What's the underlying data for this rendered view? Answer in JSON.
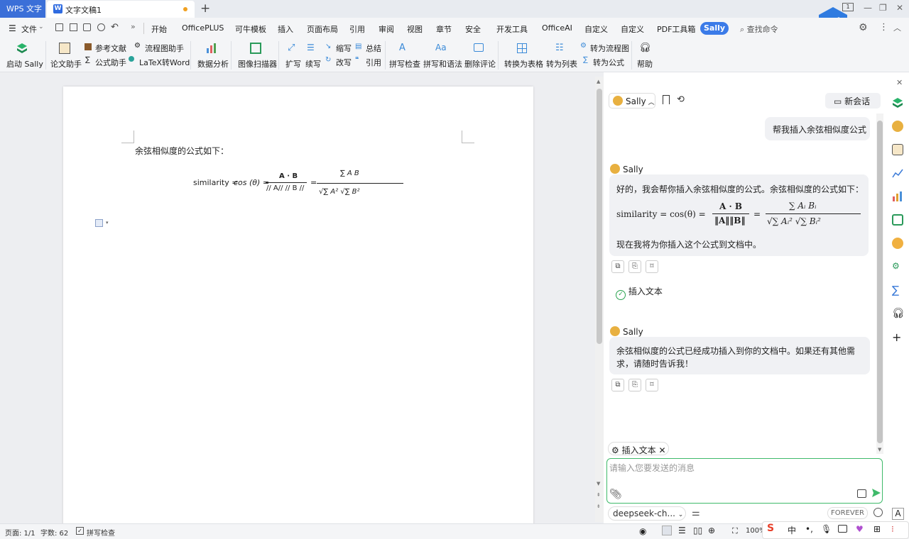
{
  "titlebar": {
    "app_name": "WPS 文字",
    "doc_tab": "文字文稿1",
    "new_tab": "+"
  },
  "menu": {
    "file": "文件",
    "items": [
      "开始",
      "OfficePLUS",
      "可牛模板",
      "插入",
      "页面布局",
      "引用",
      "审阅",
      "视图",
      "章节",
      "安全",
      "开发工具",
      "OfficeAI",
      "自定义",
      "自定义",
      "PDF工具箱"
    ],
    "active": "Sally",
    "search": "查找命令"
  },
  "ribbon": {
    "start_sally": "启动 Sally",
    "thesis": "论文助手",
    "refs": "参考文献",
    "formula": "公式助手",
    "flowchart": "流程图助手",
    "latex": "LaTeX转Word",
    "data_analysis": "数据分析",
    "image_scanner": "图像扫描器",
    "expand": "扩写",
    "continue": "续写",
    "shorten": "缩写",
    "rewrite": "改写",
    "summary": "总结",
    "quote": "引用",
    "spellcheck": "拼写检查",
    "grammar": "拼写和语法",
    "delete_comments": "删除评论",
    "to_table": "转换为表格",
    "to_list": "转为列表",
    "to_flowchart": "转为流程图",
    "to_formula": "转为公式",
    "help": "帮助"
  },
  "document": {
    "intro_text": "余弦相似度的公式如下：",
    "formula_lhs": "similarity = ",
    "formula_cos": "cos (θ) =",
    "frac1_num": "A · B",
    "frac1_den": "// A// // B //",
    "frac2_num": "∑ A B",
    "frac2_den": "√∑ A² √∑ B²"
  },
  "panel": {
    "assistant": "Sally",
    "new_chat": "新会话",
    "user_message": "帮我插入余弦相似度公式",
    "reply1_intro": "好的，我会帮你插入余弦相似度的公式。余弦相似度的公式如下：",
    "reply1_formula_lhs": "similarity = cos(θ) =",
    "reply1_frac1_num": "A · B",
    "reply1_frac1_den": "‖A‖‖B‖",
    "reply1_frac2_num": "∑ Aᵢ Bᵢ",
    "reply1_frac2_den": "√∑ Aᵢ² √∑ Bᵢ²",
    "reply1_outro": "现在我将为你插入这个公式到文档中。",
    "insert_text_status": "插入文本",
    "reply2_line1": "余弦相似度的公式已经成功插入到你的文档中。如果还有其他需",
    "reply2_line2": "求，请随时告诉我！",
    "chip": "插入文本",
    "input_placeholder": "请输入您要发送的消息",
    "model": "deepseek-ch...",
    "forever": "FOREVER"
  },
  "status": {
    "page": "页面: 1/1",
    "words": "字数: 62",
    "spell": "拼写检查",
    "zoom": "100%"
  }
}
